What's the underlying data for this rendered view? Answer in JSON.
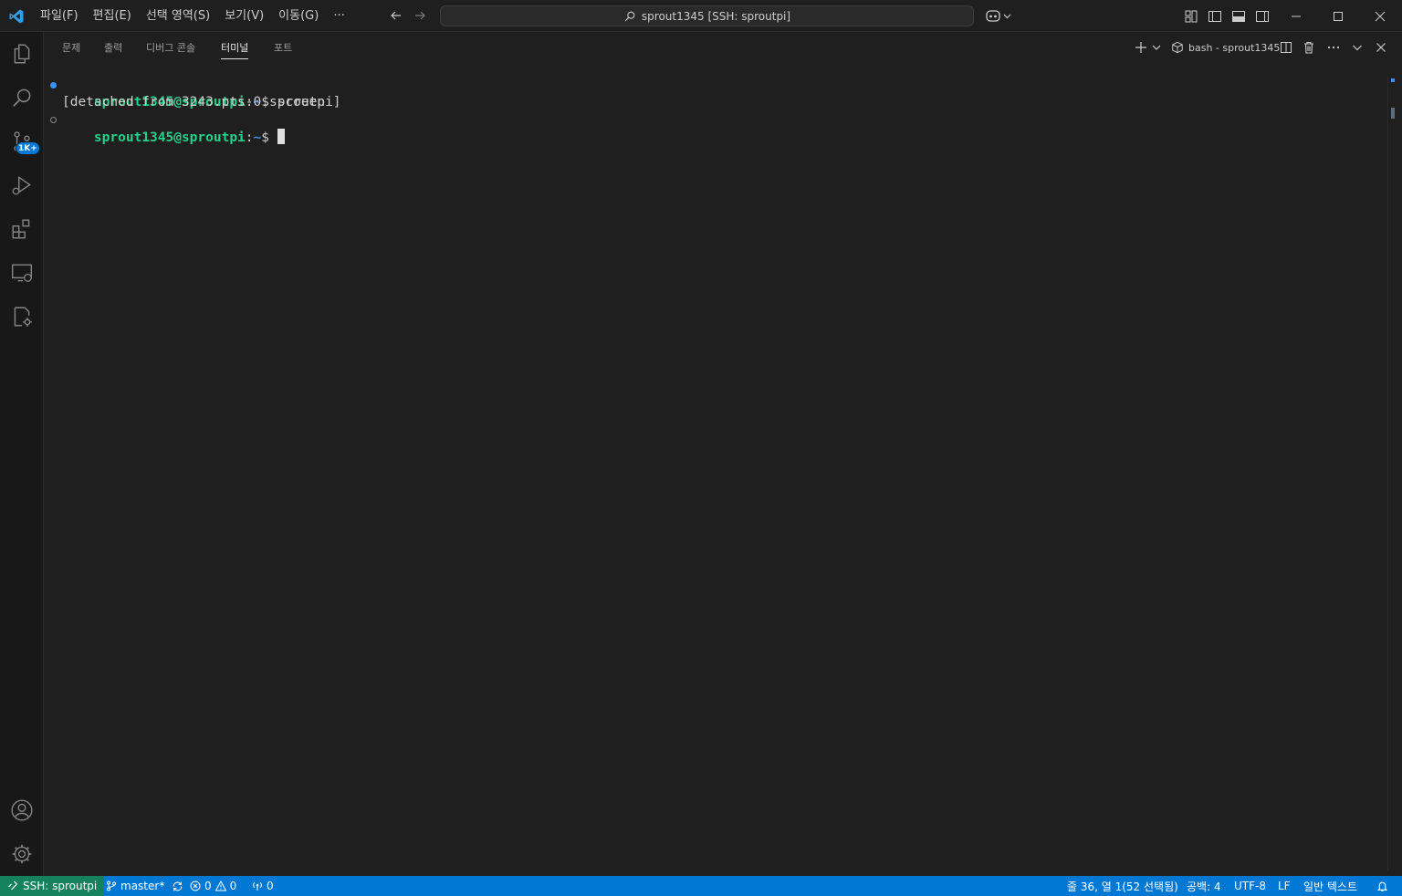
{
  "titlebar": {
    "menu": [
      "파일(F)",
      "편집(E)",
      "선택 영역(S)",
      "보기(V)",
      "이동(G)",
      "···"
    ],
    "command_center": "sprout1345 [SSH: sproutpi]"
  },
  "activity_bar": {
    "source_control_badge": "1K+"
  },
  "panel": {
    "tabs": [
      "문제",
      "출력",
      "디버그 콘솔",
      "터미널",
      "포트"
    ],
    "active_tab": "터미널",
    "terminal_name": "bash - sprout1345"
  },
  "terminal": {
    "lines": [
      {
        "user": "sprout1345@sproutpi",
        "sep": ":",
        "path": "~",
        "dollar": "$ ",
        "cmd": "screen",
        "decoration": "success"
      },
      {
        "text": "[detached from 3243.pts-0.sproutpi]"
      },
      {
        "user": "sprout1345@sproutpi",
        "sep": ":",
        "path": "~",
        "dollar": "$ ",
        "cmd": "",
        "decoration": "empty"
      }
    ]
  },
  "statusbar": {
    "remote": "SSH: sproutpi",
    "branch": "master*",
    "errors": "0",
    "warnings": "0",
    "ports": "0",
    "position": "줄 36, 열 1(52 선택됨)",
    "spaces": "공백: 4",
    "encoding": "UTF-8",
    "eol": "LF",
    "language": "일반 텍스트"
  },
  "colors": {
    "statusbar_bg": "#0078d4",
    "remote_bg": "#16825d",
    "prompt_user": "#23d18b",
    "prompt_path": "#3b8eea"
  }
}
